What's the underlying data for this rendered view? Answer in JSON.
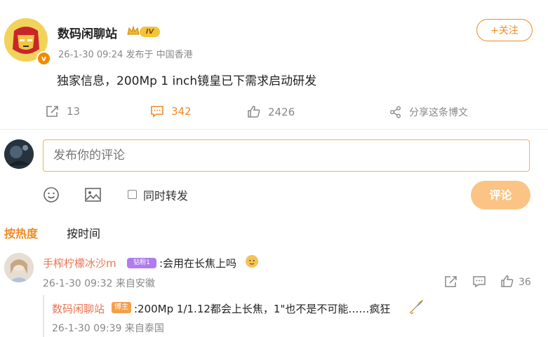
{
  "post": {
    "username": "数码闲聊站",
    "level": "IV",
    "time": "26-1-30 09:24",
    "location": "发布于 中国香港",
    "follow_label": "+关注",
    "text": "独家信息，200Mp 1 inch镜皇已下需求启动研发",
    "reposts": "13",
    "comments": "342",
    "likes": "2426",
    "share_label": "分享这条博文"
  },
  "composer": {
    "placeholder": "发布你的评论",
    "repost_label": "同时转发",
    "submit_label": "评论"
  },
  "sort_tabs": {
    "hot": "按热度",
    "time": "按时间"
  },
  "comments": [
    {
      "username": "手榨柠檬冰沙m",
      "badge": "钻粉1",
      "text": ":会用在长焦上吗",
      "time": "26-1-30 09:32 来自安徽",
      "likes": "36",
      "reply": {
        "username": "数码闲聊站",
        "badge": "博主",
        "text": ":200Mp 1/1.12都会上长焦，1\"也不是不可能……疯狂",
        "time": "26-1-30 09:39 来自泰国"
      }
    }
  ],
  "colors": {
    "accent": "#f08a24",
    "submit_disabled": "#fbc484",
    "link_name": "#eb7350",
    "input_border": "#f0b062"
  }
}
